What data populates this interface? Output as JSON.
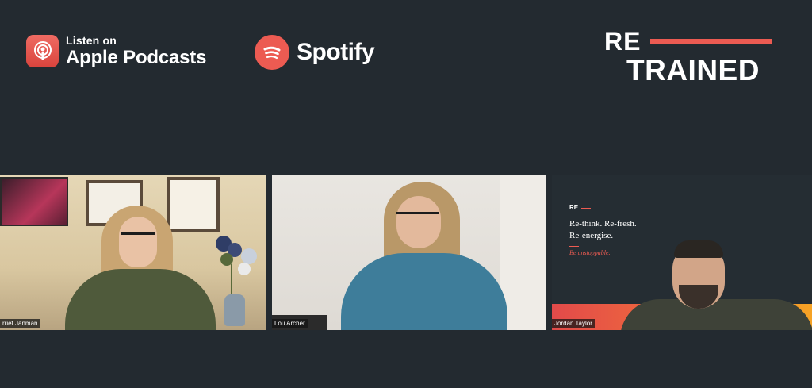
{
  "header": {
    "apple_podcasts": {
      "small_label": "Listen on",
      "big_label": "Apple Podcasts",
      "icon": "apple-podcasts-icon"
    },
    "spotify": {
      "label": "Spotify",
      "icon": "spotify-icon"
    },
    "logo": {
      "line1": "RE",
      "line2": "TRAINED",
      "accent_color": "#ec5b52"
    }
  },
  "participants": [
    {
      "name": "rriet Janman"
    },
    {
      "name": "Lou Archer"
    },
    {
      "name": "Jordan Taylor"
    }
  ],
  "branding_slide": {
    "mark": "RE",
    "line1": "Re-think. Re-fresh.",
    "line2": "Re-energise.",
    "tagline": "Be unstoppable."
  },
  "colors": {
    "background": "#232a30",
    "accent": "#ec5b52"
  }
}
